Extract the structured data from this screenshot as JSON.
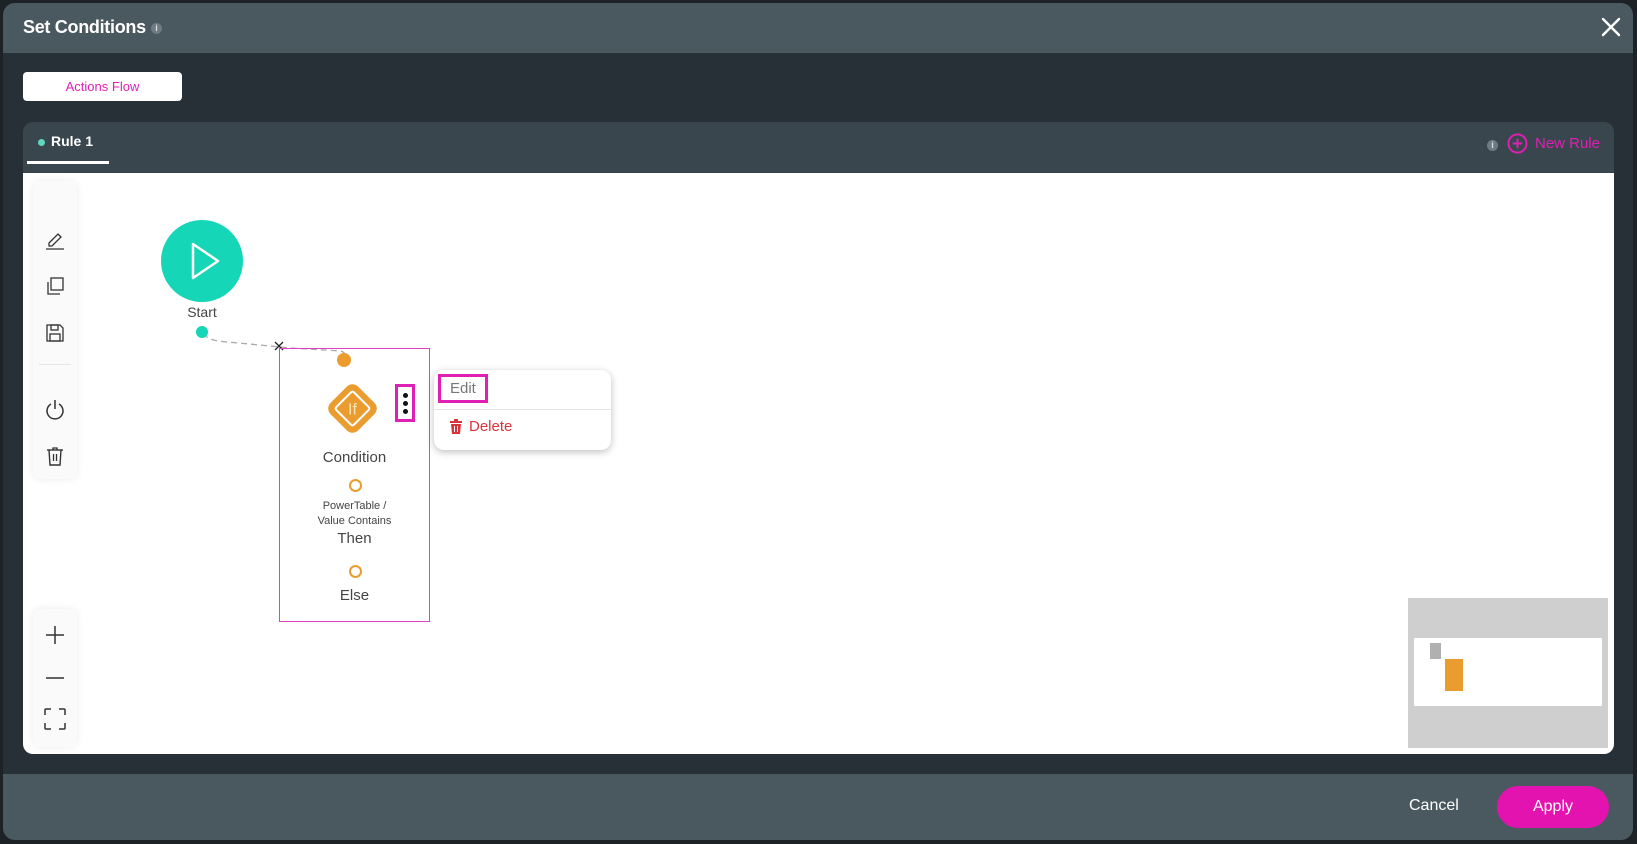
{
  "dialog": {
    "title": "Set Conditions",
    "title_info_icon": "info-icon",
    "close_icon": "close-icon"
  },
  "top_tabs": {
    "actions_flow_label": "Actions Flow"
  },
  "rules": {
    "tabs": [
      {
        "label": "Rule 1",
        "active": true,
        "status_color": "#5fd6c0"
      }
    ],
    "info_icon": "info-icon",
    "new_rule_label": "New Rule",
    "new_rule_icon": "plus-circle-icon"
  },
  "toolbar": {
    "items": [
      {
        "icon": "pencil-icon",
        "label": "Edit"
      },
      {
        "icon": "copy-icon",
        "label": "Copy"
      },
      {
        "icon": "save-icon",
        "label": "Save"
      },
      {
        "icon": "power-icon",
        "label": "Enable/Disable"
      },
      {
        "icon": "trash-icon",
        "label": "Delete"
      }
    ],
    "zoom": [
      {
        "icon": "plus-icon",
        "label": "Zoom in"
      },
      {
        "icon": "minus-icon",
        "label": "Zoom out"
      },
      {
        "icon": "fit-screen-icon",
        "label": "Fit to screen"
      }
    ]
  },
  "flow": {
    "start_node": {
      "label": "Start",
      "icon": "play-icon",
      "color": "#15d6b6"
    },
    "condition_node": {
      "label": "Condition",
      "icon_text": "If",
      "color": "#eb9c2f",
      "description_line1": "PowerTable /",
      "description_line2": "Value Contains",
      "then_label": "Then",
      "else_label": "Else",
      "selected": true
    },
    "connector_remove_label": "x"
  },
  "context_menu": {
    "edit_label": "Edit",
    "delete_label": "Delete",
    "delete_icon": "trash-icon"
  },
  "footer": {
    "cancel_label": "Cancel",
    "apply_label": "Apply"
  },
  "colors": {
    "accent": "#e01fb4",
    "start": "#15d6b6",
    "condition": "#eb9c2f",
    "danger": "#d9343c"
  }
}
